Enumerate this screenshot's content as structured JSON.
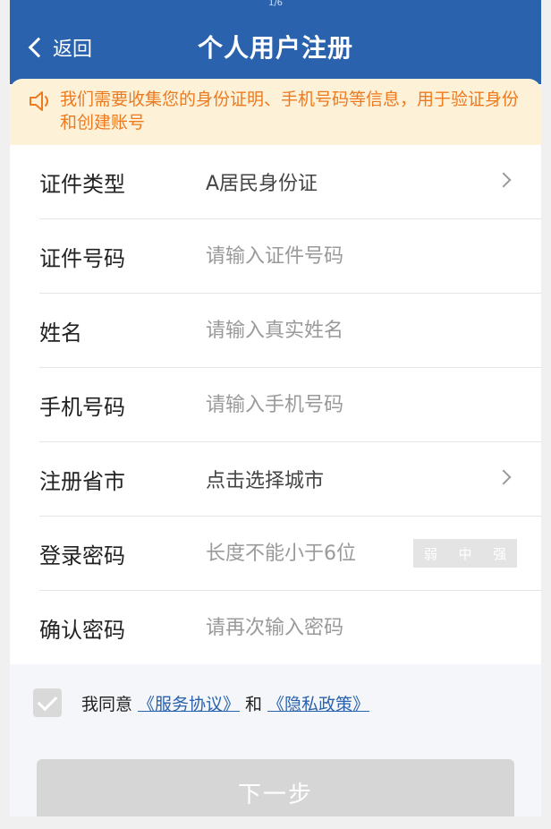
{
  "status_bar": {
    "text": "1/6"
  },
  "header": {
    "back_label": "返回",
    "title": "个人用户注册"
  },
  "notice": {
    "text": "我们需要收集您的身份证明、手机号码等信息，用于验证身份和创建账号",
    "icon": "speaker-icon"
  },
  "form": {
    "rows": [
      {
        "label": "证件类型",
        "value": "A居民身份证"
      },
      {
        "label": "证件号码",
        "placeholder": "请输入证件号码"
      },
      {
        "label": "姓名",
        "placeholder": "请输入真实姓名"
      },
      {
        "label": "手机号码",
        "placeholder": "请输入手机号码"
      },
      {
        "label": "注册省市",
        "value": "点击选择城市"
      },
      {
        "label": "登录密码",
        "placeholder": "长度不能小于6位"
      },
      {
        "label": "确认密码",
        "placeholder": "请再次输入密码"
      }
    ],
    "strength": [
      "弱",
      "中",
      "强"
    ]
  },
  "agreement": {
    "prefix": "我同意",
    "service": "《服务协议》",
    "and": "和",
    "privacy": "《隐私政策》"
  },
  "next_button": {
    "label": "下一步"
  },
  "colors": {
    "primary": "#2a62ad",
    "notice_bg": "#fdf1d8",
    "notice_text": "#ee7a1f",
    "disabled": "#d6d6d6"
  }
}
